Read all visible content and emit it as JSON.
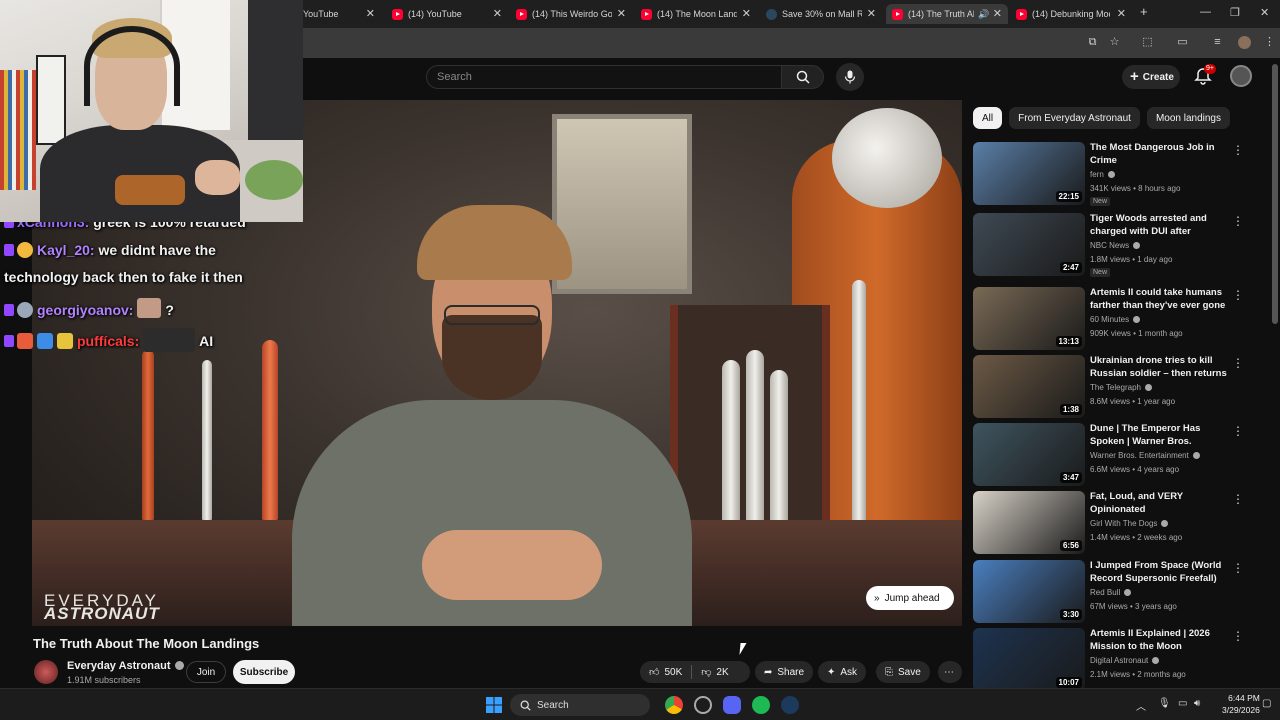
{
  "browser": {
    "tabs": [
      {
        "label": "YouTube",
        "icon": "youtube-icon"
      },
      {
        "label": "(14) YouTube",
        "icon": "youtube-icon"
      },
      {
        "label": "(14) This Weirdo Got",
        "icon": "youtube-icon"
      },
      {
        "label": "(14) The Moon Landin",
        "icon": "youtube-icon"
      },
      {
        "label": "Save 30% on Mall Riv",
        "icon": "steam-icon"
      },
      {
        "label": "(14) The Truth Ab",
        "icon": "youtube-icon",
        "active": true
      },
      {
        "label": "(14) Debunking Moo",
        "icon": "youtube-icon"
      }
    ],
    "new_tab": "+"
  },
  "chat": {
    "messages": [
      {
        "user": "xCannon3:",
        "text": "greek is 100% retarded",
        "color": "#9c6cff"
      },
      {
        "user": "Kayl_20:",
        "text": "we didnt have the",
        "text2": "technology back then to fake it then",
        "color": "#b283ff"
      },
      {
        "user": "georgiyoanov:",
        "text": "?",
        "color": "#b283ff"
      },
      {
        "user": "puffícals:",
        "text": "AI",
        "color": "#ff3b3b"
      }
    ]
  },
  "youtube": {
    "search_placeholder": "Search",
    "create_label": "Create",
    "notification_count": "9+",
    "video": {
      "title": "The Truth About The Moon Landings",
      "watermark_line1": "EVERYDAY",
      "watermark_line2": "ASTRONAUT",
      "jump_label": "Jump ahead"
    },
    "channel": {
      "name": "Everyday Astronaut",
      "subscribers": "1.91M subscribers",
      "join_label": "Join",
      "subscribe_label": "Subscribe"
    },
    "actions": {
      "likes": "50K",
      "dislikes": "2K",
      "share": "Share",
      "ask": "Ask",
      "save": "Save"
    },
    "chips": [
      "All",
      "From Everyday Astronaut",
      "Moon landings"
    ],
    "recommendations": [
      {
        "title": "The Most Dangerous Job in Crime",
        "channel": "fern",
        "meta": "341K views • 8 hours ago",
        "badge": "New",
        "duration": "22:15",
        "thumb": "#5a7fa8"
      },
      {
        "title": "Tiger Woods arrested and charged with DUI after rollover...",
        "channel": "NBC News",
        "meta": "1.8M views • 1 day ago",
        "badge": "New",
        "duration": "2:47",
        "thumb": "#3f4a55"
      },
      {
        "title": "Artemis II could take humans farther than they've ever gone ...",
        "channel": "60 Minutes",
        "meta": "909K views • 1 month ago",
        "badge": "",
        "duration": "13:13",
        "thumb": "#7a6a55"
      },
      {
        "title": "Ukrainian drone tries to kill Russian soldier – then returns ...",
        "channel": "The Telegraph",
        "meta": "8.6M views • 1 year ago",
        "badge": "",
        "duration": "1:38",
        "thumb": "#6d5a45"
      },
      {
        "title": "Dune | The Emperor Has Spoken | Warner Bros. Entertainment",
        "channel": "Warner Bros. Entertainment",
        "meta": "6.6M views • 4 years ago",
        "badge": "",
        "duration": "3:47",
        "thumb": "#3f5560"
      },
      {
        "title": "Fat, Loud, and VERY Opinionated",
        "channel": "Girl With The Dogs",
        "meta": "1.4M views • 2 weeks ago",
        "badge": "",
        "duration": "6:56",
        "thumb": "#d8d2c8"
      },
      {
        "title": "I Jumped From Space (World Record Supersonic Freefall)",
        "channel": "Red Bull",
        "meta": "67M views • 3 years ago",
        "badge": "",
        "duration": "3:30",
        "thumb": "#4a7fc0"
      },
      {
        "title": "Artemis II Explained | 2026 Mission to the Moon",
        "channel": "Digital Astronaut",
        "meta": "2.1M views • 2 months ago",
        "badge": "",
        "duration": "10:07",
        "thumb": "#1d3350"
      }
    ]
  },
  "taskbar": {
    "search_label": "Search",
    "time": "6:44 PM",
    "date": "3/29/2026"
  }
}
